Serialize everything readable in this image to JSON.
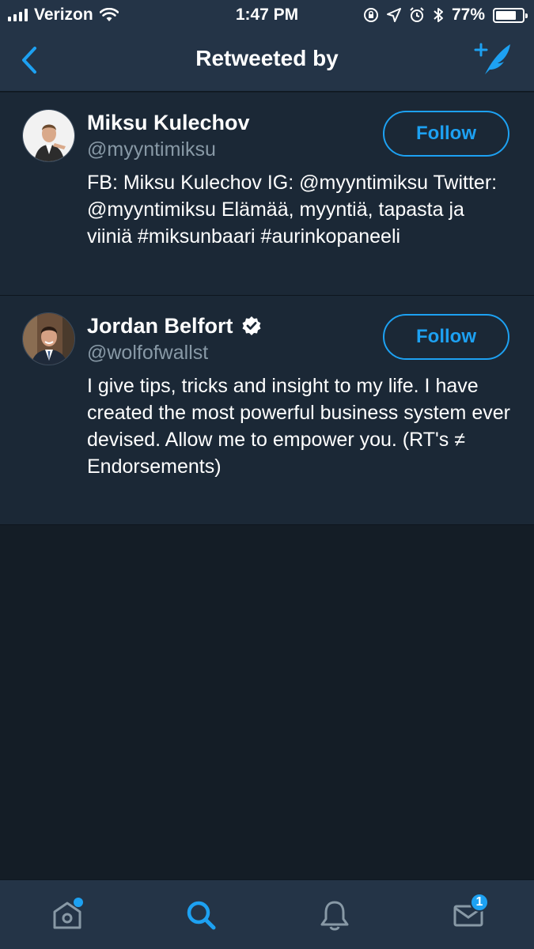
{
  "status_bar": {
    "carrier": "Verizon",
    "time": "1:47 PM",
    "battery_percent": "77%",
    "battery_level": 0.77,
    "icons": [
      "signal-icon",
      "wifi-icon",
      "lock-rotation-icon",
      "location-icon",
      "alarm-icon",
      "bluetooth-icon",
      "battery-icon"
    ]
  },
  "nav": {
    "title": "Retweeted by",
    "back_icon": "chevron-left-icon",
    "compose_icon": "compose-tweet-icon"
  },
  "users": [
    {
      "name": "Miksu Kulechov",
      "handle": "@myyntimiksu",
      "bio": "FB: Miksu Kulechov IG: @myyntimiksu Twitter: @myyntimiksu Elämää, myyntiä, tapasta ja viiniä #miksunbaari #aurinkopaneeli",
      "follow_label": "Follow",
      "verified": false
    },
    {
      "name": "Jordan Belfort",
      "handle": "@wolfofwallst",
      "bio": "I give tips, tricks and insight to my life. I have created the most powerful business system ever devised. Allow me to empower you. (RT's ≠ Endorsements)",
      "follow_label": "Follow",
      "verified": true
    }
  ],
  "tab_bar": {
    "tabs": [
      {
        "icon": "home-icon",
        "active": false
      },
      {
        "icon": "search-icon",
        "active": true
      },
      {
        "icon": "notifications-icon",
        "active": false
      },
      {
        "icon": "messages-icon",
        "active": false
      }
    ],
    "messages_badge": "1"
  },
  "colors": {
    "accent": "#1da1f2",
    "background": "#141d26",
    "cell": "#1b2836",
    "bar": "#243447",
    "secondary_text": "#8899a6"
  }
}
